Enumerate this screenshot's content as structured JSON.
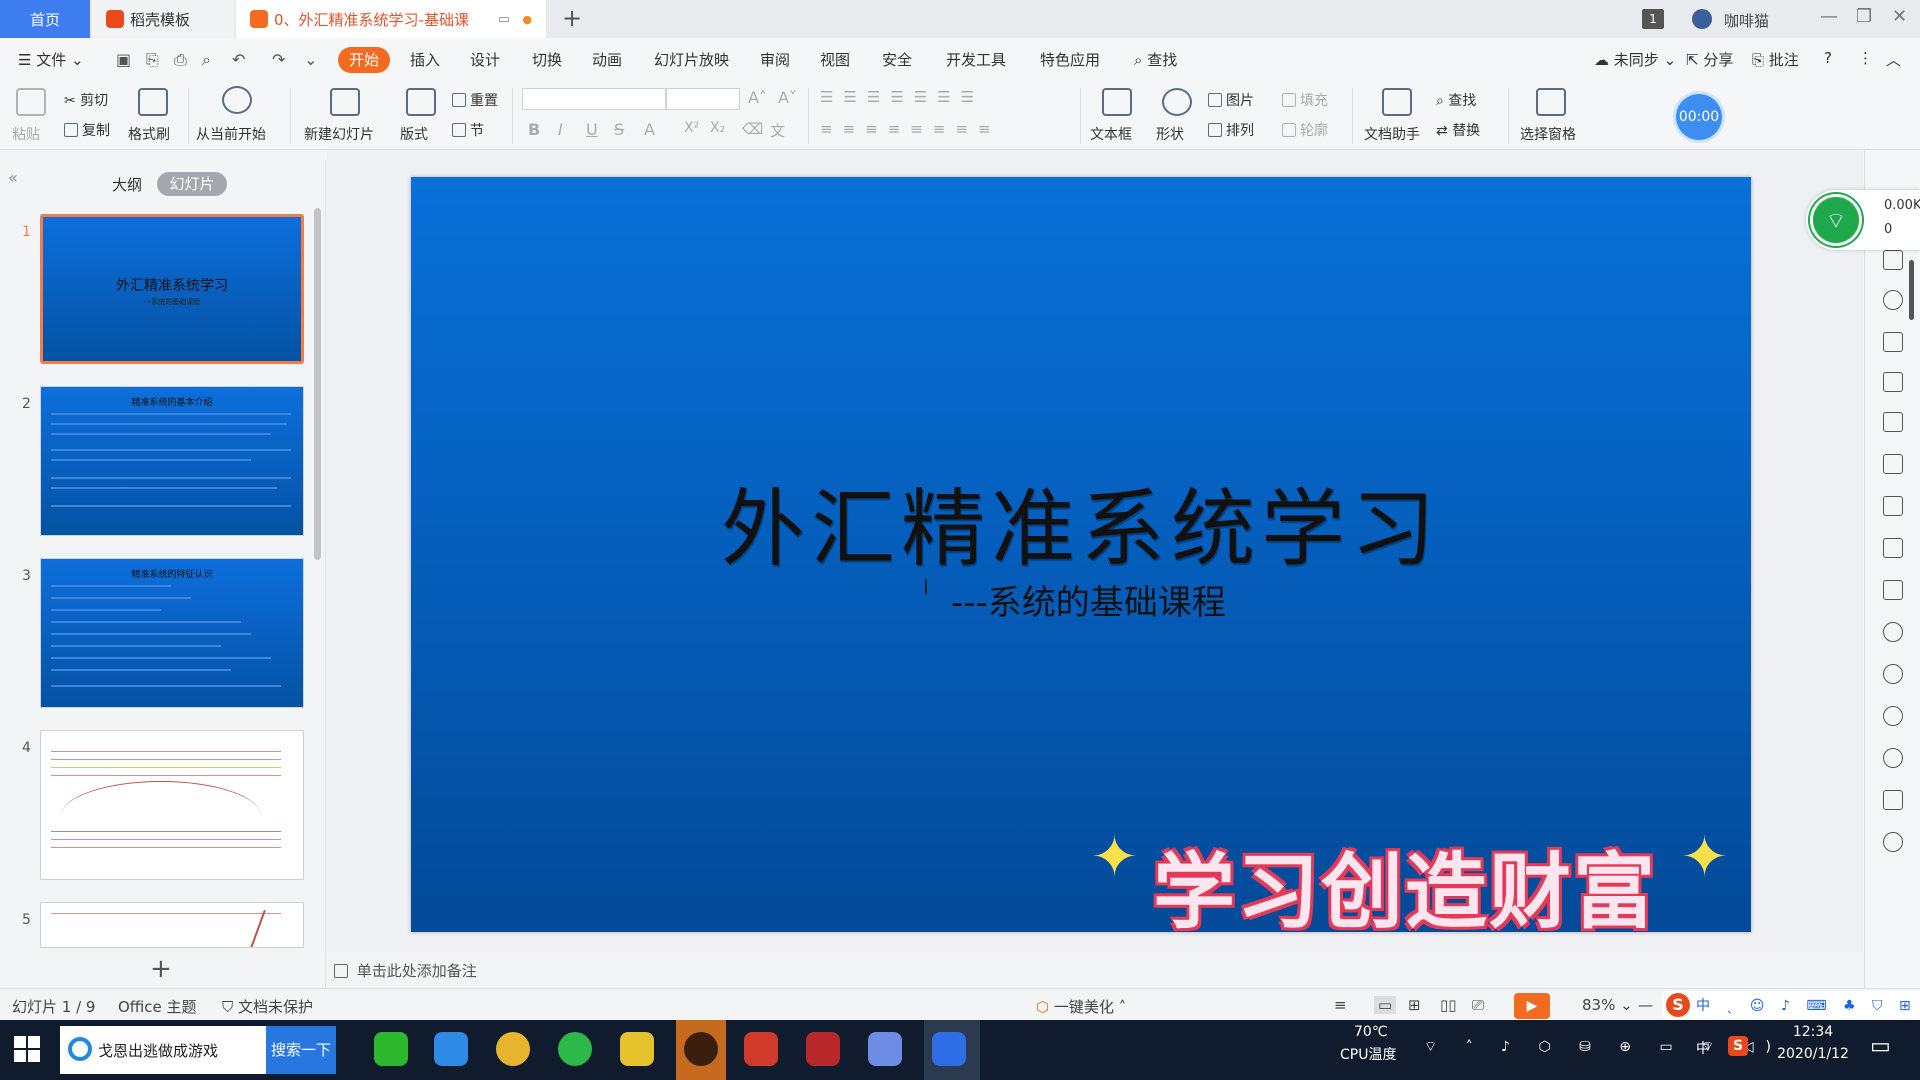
{
  "titlebar": {
    "tabs": {
      "home": "首页",
      "template": "稻壳模板",
      "doc": "0、外汇精准系统学习-基础课"
    },
    "window_count": "1",
    "user_name": "咖啡猫"
  },
  "menu": {
    "file": "文件",
    "items": [
      "开始",
      "插入",
      "设计",
      "切换",
      "动画",
      "幻灯片放映",
      "审阅",
      "视图",
      "安全",
      "开发工具",
      "特色应用"
    ],
    "search": "查找",
    "sync": "未同步",
    "share": "分享",
    "comment": "批注"
  },
  "ribbon": {
    "paste": "粘贴",
    "cut": "剪切",
    "copy": "复制",
    "format_painter": "格式刷",
    "from_current": "从当前开始",
    "new_slide": "新建幻灯片",
    "layout": "版式",
    "reset": "重置",
    "section": "节",
    "textbox": "文本框",
    "shape": "形状",
    "picture": "图片",
    "arrange": "排列",
    "fill": "填充",
    "outline": "轮廓",
    "doc_assistant": "文档助手",
    "find": "查找",
    "replace": "替换",
    "selection_pane": "选择窗格",
    "timer": "00:00"
  },
  "leftpane": {
    "outline_tab": "大纲",
    "slides_tab": "幻灯片",
    "slide_numbers": [
      "1",
      "2",
      "3",
      "4",
      "5"
    ],
    "thumb1_title": "外汇精准系统学习",
    "thumb1_sub": "---系统的基础课程",
    "thumb2_title": "精准系统的基本介绍",
    "thumb3_title": "精准系统的特征认识"
  },
  "slide": {
    "title": "外汇精准系统学习",
    "subtitle": "---系统的基础课程",
    "banner": "学习创造财富",
    "notes_placeholder": "单击此处添加备注"
  },
  "network": {
    "upload": "0.00K",
    "download": "0"
  },
  "statusbar": {
    "slide_index": "幻灯片 1 / 9",
    "theme": "Office 主题",
    "protection": "文档未保护",
    "beautify": "一键美化",
    "zoom": "83%"
  },
  "taskbar": {
    "search_text": "戈恩出逃做成游戏",
    "search_button": "搜索一下",
    "cpu_temp": "70℃",
    "cpu_label": "CPU温度",
    "ime_lang": "中",
    "time": "12:34",
    "date": "2020/1/12"
  },
  "colors": {
    "accent": "#f26b21",
    "home_tab": "#3d7df0",
    "slide_blue": "#0870d8",
    "banner_red": "#e43a5a"
  }
}
